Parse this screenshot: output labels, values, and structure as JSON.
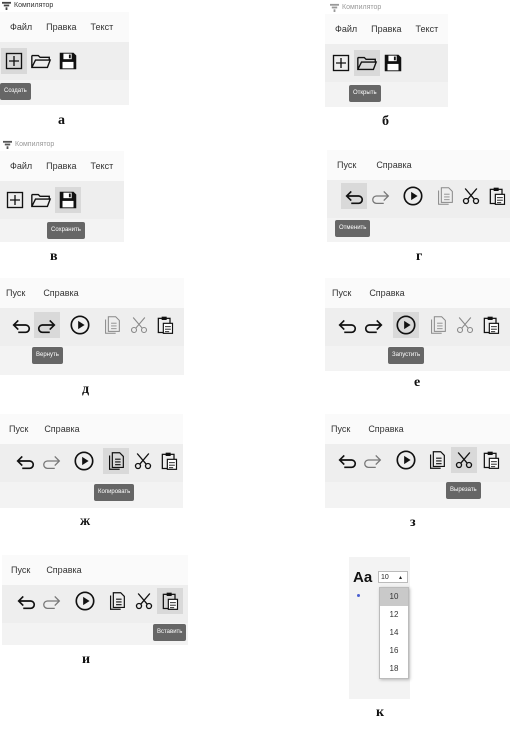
{
  "app_title": "Компилятор",
  "menu_file": [
    "Файл",
    "Правка",
    "Текст"
  ],
  "menu_run": [
    "Пуск",
    "Справка"
  ],
  "tooltips": {
    "a": "Создать",
    "b": "Открыть",
    "v": "Сохранить",
    "g": "Отменить",
    "d": "Вернуть",
    "e": "Запустить",
    "zh": "Копировать",
    "z": "Вырезать",
    "i": "Вставить"
  },
  "captions": [
    "а",
    "б",
    "в",
    "г",
    "д",
    "е",
    "ж",
    "з",
    "и",
    "к"
  ],
  "font_panel": {
    "sample": "Aa",
    "selected_size": "10",
    "sizes": [
      "10",
      "12",
      "14",
      "16",
      "18"
    ]
  },
  "colors": {
    "tooltip_bg": "#666666",
    "toolbar_bg": "#eeeeee",
    "highlight": "#d9d9d9"
  }
}
